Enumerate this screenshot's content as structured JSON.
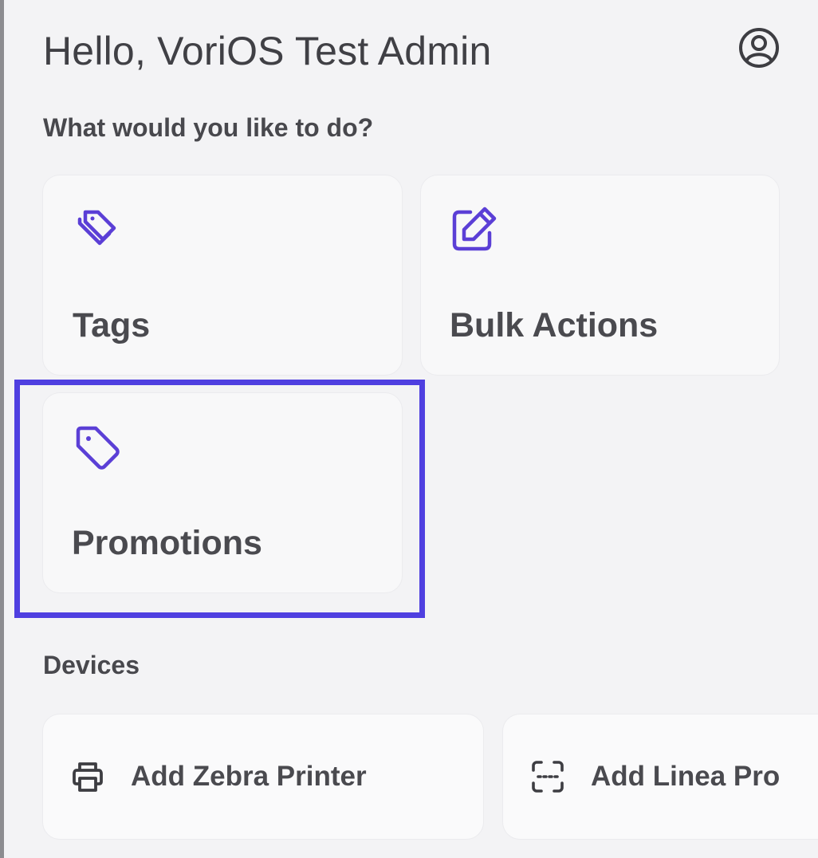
{
  "header": {
    "greeting": "Hello, VoriOS Test Admin",
    "profile_icon": "user-circle-icon"
  },
  "actions": {
    "prompt": "What would you like to do?",
    "items": [
      {
        "label": "Tags",
        "icon": "tags-icon"
      },
      {
        "label": "Bulk Actions",
        "icon": "edit-icon"
      },
      {
        "label": "Promotions",
        "icon": "tag-icon",
        "highlighted": true
      }
    ]
  },
  "devices": {
    "title": "Devices",
    "items": [
      {
        "label": "Add Zebra Printer",
        "icon": "printer-icon"
      },
      {
        "label": "Add Linea Pro",
        "icon": "scanner-icon"
      }
    ]
  },
  "colors": {
    "accent": "#5b3fd6",
    "highlight_border": "#4f3fe0",
    "background": "#f3f3f5",
    "card": "#f8f8f9",
    "text": "#404045"
  }
}
